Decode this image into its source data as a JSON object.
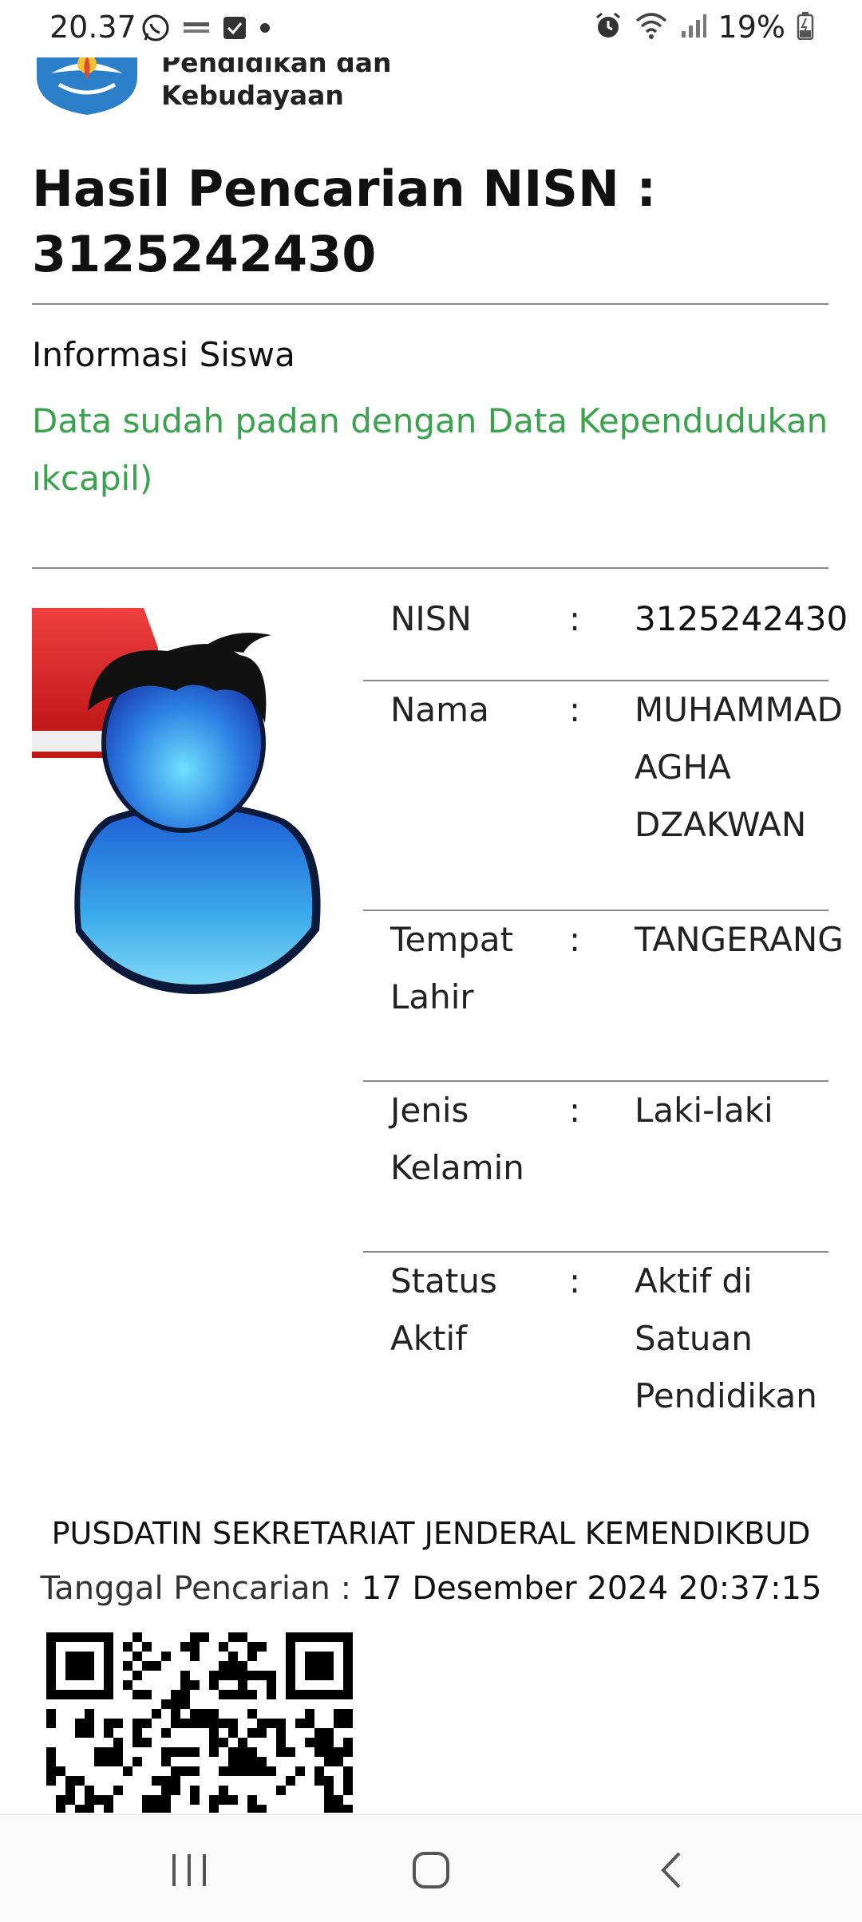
{
  "status_bar": {
    "time": "20.37",
    "battery": "19%",
    "icons_left": [
      "whatsapp-icon",
      "grab-merchant-icon",
      "checkbox-icon",
      "dot-icon"
    ],
    "icons_right": [
      "alarm-icon",
      "wifi-icon",
      "signal-icon",
      "battery-icon"
    ]
  },
  "header": {
    "logo_line1": "Pendidikan dan",
    "logo_line2": "Kebudayaan"
  },
  "result": {
    "title_line1": "Hasil Pencarian NISN :",
    "title_line2": "3125242430"
  },
  "info": {
    "heading": "Informasi Siswa",
    "verified_line1": "Data sudah padan dengan Data Kependudukan",
    "verified_line2": "ıkcapil)"
  },
  "details": [
    {
      "label": "NISN",
      "colon": ":",
      "value": "3125242430"
    },
    {
      "label": "Nama",
      "colon": ":",
      "value": "MUHAMMAD AGHA DZAKWAN"
    },
    {
      "label": "Tempat Lahir",
      "colon": ":",
      "value": "TANGERANG"
    },
    {
      "label": "Jenis Kelamin",
      "colon": ":",
      "value": "Laki-laki"
    },
    {
      "label": "Status Aktif",
      "colon": ":",
      "value": "Aktif di Satuan Pendidikan"
    }
  ],
  "footer": {
    "org": "PUSDATIN SEKRETARIAT JENDERAL KEMENDIKBUD",
    "date_label": "Tanggal Pencarian : ",
    "date_value": "17 Desember 2024 20:37:15"
  },
  "colors": {
    "accent_green": "#3aa14d",
    "rule": "#888888"
  }
}
